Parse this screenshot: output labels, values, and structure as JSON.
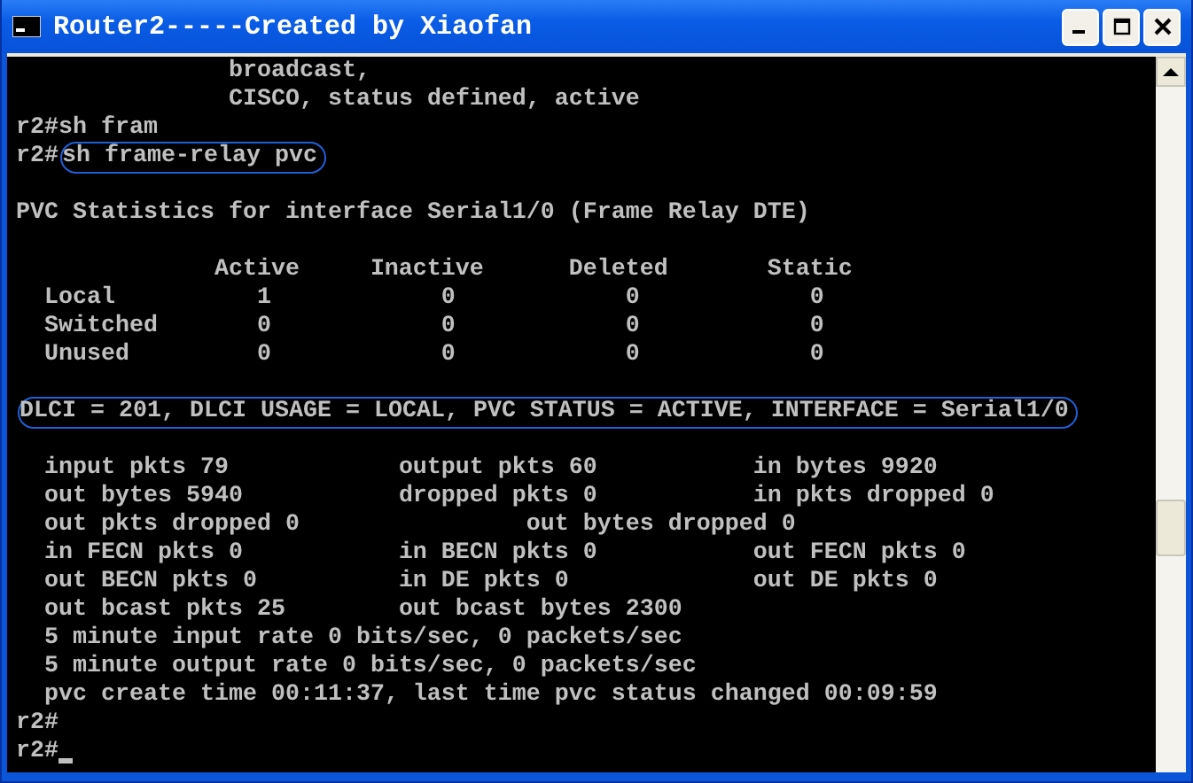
{
  "window": {
    "title": "Router2-----Created by Xiaofan"
  },
  "console": {
    "lines": [
      {
        "kind": "continuation",
        "text": "broadcast,"
      },
      {
        "kind": "continuation",
        "text": "CISCO, status defined, active"
      },
      {
        "kind": "prompt",
        "prompt": "r2#",
        "command": "sh fram",
        "circled": false
      },
      {
        "kind": "prompt",
        "prompt": "r2#",
        "command": "sh frame-relay pvc",
        "circled": true
      },
      {
        "kind": "plain",
        "text": "PVC Statistics for interface Serial1/0 (Frame Relay DTE)",
        "gap_before": true
      },
      {
        "kind": "table_header",
        "cells": [
          "Active",
          "Inactive",
          "Deleted",
          "Static"
        ],
        "gap_before": true
      },
      {
        "kind": "table_row",
        "cells": [
          "Local",
          "1",
          "0",
          "0",
          "0"
        ]
      },
      {
        "kind": "table_row",
        "cells": [
          "Switched",
          "0",
          "0",
          "0",
          "0"
        ]
      },
      {
        "kind": "table_row",
        "cells": [
          "Unused",
          "0",
          "0",
          "0",
          "0"
        ]
      },
      {
        "kind": "plain",
        "text": "DLCI = 201, DLCI USAGE = LOCAL, PVC STATUS = ACTIVE, INTERFACE = Serial1/0",
        "gap_before": true,
        "circled": true
      },
      {
        "kind": "stats",
        "cells": [
          "input pkts 79",
          "output pkts 60",
          "in bytes 9920"
        ],
        "gap_before": true
      },
      {
        "kind": "stats",
        "cells": [
          "out bytes 5940",
          "dropped pkts 0",
          "in pkts dropped 0"
        ]
      },
      {
        "kind": "stats_wide",
        "cells": [
          "out pkts dropped 0",
          "out bytes dropped 0"
        ]
      },
      {
        "kind": "stats",
        "cells": [
          "in FECN pkts 0",
          "in BECN pkts 0",
          "out FECN pkts 0"
        ]
      },
      {
        "kind": "stats",
        "cells": [
          "out BECN pkts 0",
          "in DE pkts 0",
          "out DE pkts 0"
        ]
      },
      {
        "kind": "stats",
        "cells": [
          "out bcast pkts 25",
          "out bcast bytes 2300"
        ]
      },
      {
        "kind": "indented",
        "text": "5 minute input rate 0 bits/sec, 0 packets/sec"
      },
      {
        "kind": "indented",
        "text": "5 minute output rate 0 bits/sec, 0 packets/sec"
      },
      {
        "kind": "indented",
        "text": "pvc create time 00:11:37, last time pvc status changed 00:09:59"
      },
      {
        "kind": "prompt",
        "prompt": "r2#"
      },
      {
        "kind": "prompt",
        "prompt": "r2#",
        "cursor": true
      }
    ]
  }
}
